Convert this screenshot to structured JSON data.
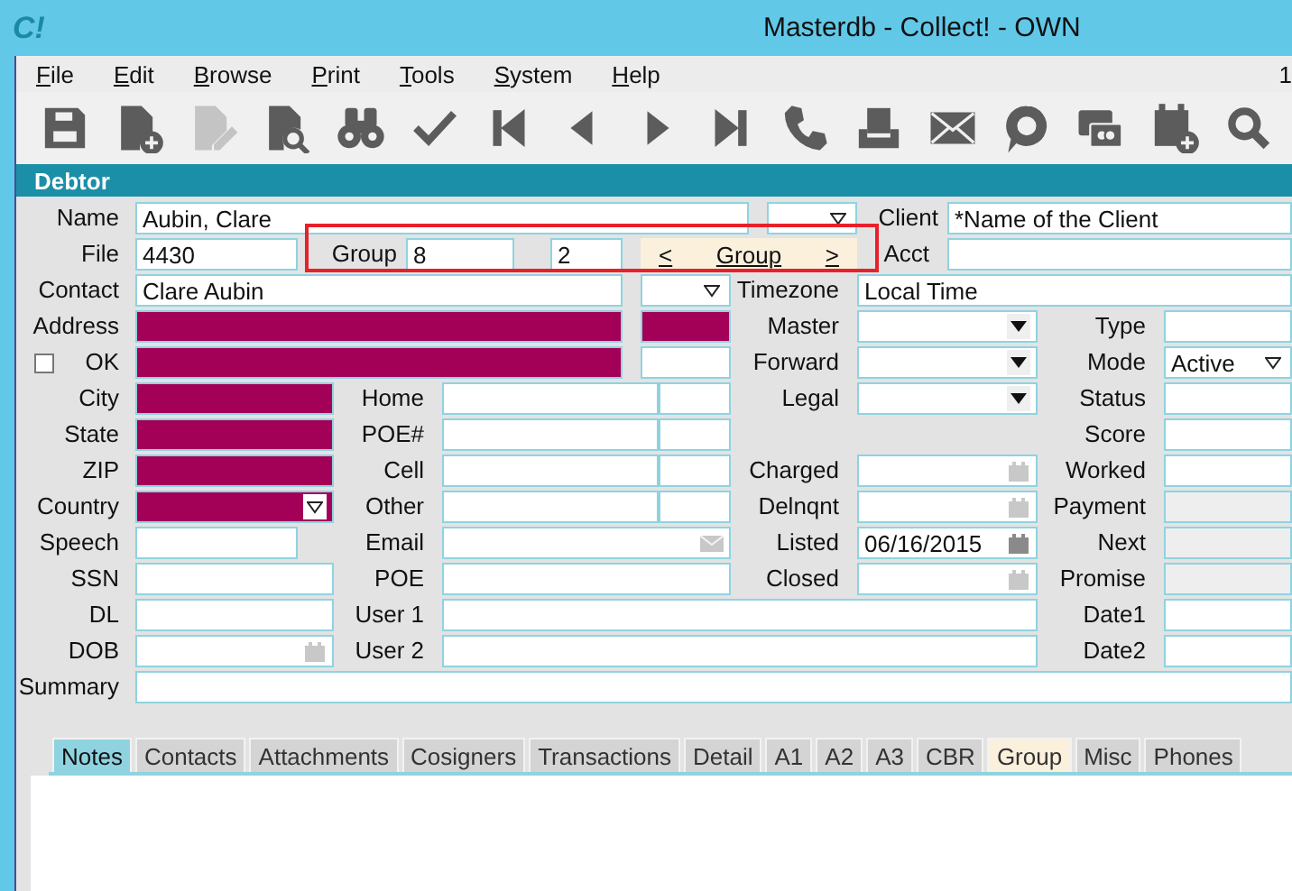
{
  "window": {
    "logo": "C!",
    "title": "Masterdb - Collect! - OWN"
  },
  "menu": [
    "File",
    "Edit",
    "Browse",
    "Print",
    "Tools",
    "System",
    "Help"
  ],
  "menu_extra": "1",
  "toolbar": [
    {
      "kind": "save",
      "disabled": false
    },
    {
      "kind": "new",
      "disabled": false
    },
    {
      "kind": "edit",
      "disabled": true
    },
    {
      "kind": "finddoc",
      "disabled": false
    },
    {
      "kind": "binoculars",
      "disabled": false
    },
    {
      "kind": "check",
      "disabled": false
    },
    {
      "kind": "first",
      "disabled": false
    },
    {
      "kind": "prev",
      "disabled": false
    },
    {
      "kind": "next",
      "disabled": false
    },
    {
      "kind": "last",
      "disabled": false
    },
    {
      "kind": "phone",
      "disabled": false
    },
    {
      "kind": "tray",
      "disabled": false
    },
    {
      "kind": "mail",
      "disabled": false
    },
    {
      "kind": "chat",
      "disabled": false
    },
    {
      "kind": "card",
      "disabled": false
    },
    {
      "kind": "calendar",
      "disabled": false
    },
    {
      "kind": "search",
      "disabled": false
    }
  ],
  "section": "Debtor",
  "group_box": {
    "highlighted": true
  },
  "form": [
    [
      {
        "kind": "label",
        "text": "Name"
      },
      {
        "kind": "field",
        "value": "Aubin, Clare"
      },
      {
        "kind": "combo"
      },
      {
        "kind": "label",
        "text": "Client"
      },
      {
        "kind": "field",
        "value": "*Name of the Client"
      }
    ],
    [
      {
        "kind": "label",
        "text": "File"
      },
      {
        "kind": "field",
        "value": "4430"
      },
      {
        "kind": "label",
        "text": "Group"
      },
      {
        "kind": "field",
        "value": "8"
      },
      {
        "kind": "field",
        "value": "2"
      },
      {
        "kind": "nav",
        "prev": "<",
        "text": "Group",
        "next": ">"
      },
      {
        "kind": "label",
        "text": "Acct"
      },
      {
        "kind": "field"
      }
    ],
    [
      {
        "kind": "label",
        "text": "Contact"
      },
      {
        "kind": "field",
        "value": "Clare Aubin"
      },
      {
        "kind": "combo"
      },
      {
        "kind": "label",
        "text": "Timezone"
      },
      {
        "kind": "field",
        "value": "Local Time"
      }
    ],
    [
      {
        "kind": "label",
        "text": "Address"
      },
      {
        "kind": "field",
        "required": true
      },
      {
        "kind": "field",
        "required": true
      },
      {
        "kind": "label",
        "text": "Master"
      },
      {
        "kind": "select"
      },
      {
        "kind": "label",
        "text": "Type"
      },
      {
        "kind": "field"
      }
    ],
    [
      {
        "kind": "check",
        "checked": false
      },
      {
        "kind": "label",
        "text": "OK"
      },
      {
        "kind": "field",
        "required": true
      },
      {
        "kind": "field"
      },
      {
        "kind": "label",
        "text": "Forward"
      },
      {
        "kind": "select"
      },
      {
        "kind": "label",
        "text": "Mode"
      },
      {
        "kind": "combo",
        "value": "Active"
      }
    ],
    [
      {
        "kind": "label",
        "text": "City"
      },
      {
        "kind": "field",
        "required": true
      },
      {
        "kind": "label",
        "text": "Home"
      },
      {
        "kind": "field"
      },
      {
        "kind": "field"
      },
      {
        "kind": "label",
        "text": "Legal"
      },
      {
        "kind": "select"
      },
      {
        "kind": "label",
        "text": "Status"
      },
      {
        "kind": "field"
      }
    ],
    [
      {
        "kind": "label",
        "text": "State"
      },
      {
        "kind": "field",
        "required": true
      },
      {
        "kind": "label",
        "text": "POE#"
      },
      {
        "kind": "field"
      },
      {
        "kind": "field"
      },
      {
        "kind": "label",
        "text": "Score"
      },
      {
        "kind": "field"
      }
    ],
    [
      {
        "kind": "label",
        "text": "ZIP"
      },
      {
        "kind": "field",
        "required": true
      },
      {
        "kind": "label",
        "text": "Cell"
      },
      {
        "kind": "field"
      },
      {
        "kind": "field"
      },
      {
        "kind": "label",
        "text": "Charged"
      },
      {
        "kind": "date"
      },
      {
        "kind": "label",
        "text": "Worked"
      },
      {
        "kind": "field"
      }
    ],
    [
      {
        "kind": "label",
        "text": "Country"
      },
      {
        "kind": "combo",
        "required": true
      },
      {
        "kind": "label",
        "text": "Other"
      },
      {
        "kind": "field"
      },
      {
        "kind": "field"
      },
      {
        "kind": "label",
        "text": "Delnqnt"
      },
      {
        "kind": "date"
      },
      {
        "kind": "label",
        "text": "Payment"
      },
      {
        "kind": "field",
        "disabled": true
      }
    ],
    [
      {
        "kind": "label",
        "text": "Speech"
      },
      {
        "kind": "field"
      },
      {
        "kind": "label",
        "text": "Email"
      },
      {
        "kind": "email"
      },
      {
        "kind": "label",
        "text": "Listed"
      },
      {
        "kind": "date",
        "value": "06/16/2015"
      },
      {
        "kind": "label",
        "text": "Next"
      },
      {
        "kind": "field",
        "disabled": true
      }
    ],
    [
      {
        "kind": "label",
        "text": "SSN"
      },
      {
        "kind": "field"
      },
      {
        "kind": "label",
        "text": "POE"
      },
      {
        "kind": "field"
      },
      {
        "kind": "label",
        "text": "Closed"
      },
      {
        "kind": "date"
      },
      {
        "kind": "label",
        "text": "Promise"
      },
      {
        "kind": "field",
        "disabled": true
      }
    ],
    [
      {
        "kind": "label",
        "text": "DL"
      },
      {
        "kind": "field"
      },
      {
        "kind": "label",
        "text": "User 1"
      },
      {
        "kind": "field"
      },
      {
        "kind": "label",
        "text": "Date1"
      },
      {
        "kind": "field"
      }
    ],
    [
      {
        "kind": "label",
        "text": "DOB"
      },
      {
        "kind": "date"
      },
      {
        "kind": "label",
        "text": "User 2"
      },
      {
        "kind": "field"
      },
      {
        "kind": "label",
        "text": "Date2"
      },
      {
        "kind": "field"
      }
    ],
    [
      {
        "kind": "label",
        "text": "Summary"
      },
      {
        "kind": "field"
      }
    ]
  ],
  "tabs": [
    {
      "label": "Notes",
      "selected": true,
      "highlighted": false
    },
    {
      "label": "Contacts",
      "selected": false,
      "highlighted": false
    },
    {
      "label": "Attachments",
      "selected": false,
      "highlighted": false
    },
    {
      "label": "Cosigners",
      "selected": false,
      "highlighted": false
    },
    {
      "label": "Transactions",
      "selected": false,
      "highlighted": false
    },
    {
      "label": "Detail",
      "selected": false,
      "highlighted": false
    },
    {
      "label": "A1",
      "selected": false,
      "highlighted": false
    },
    {
      "label": "A2",
      "selected": false,
      "highlighted": false
    },
    {
      "label": "A3",
      "selected": false,
      "highlighted": false
    },
    {
      "label": "CBR",
      "selected": false,
      "highlighted": false
    },
    {
      "label": "Group",
      "selected": false,
      "highlighted": true
    },
    {
      "label": "Misc",
      "selected": false,
      "highlighted": false
    },
    {
      "label": "Phones",
      "selected": false,
      "highlighted": false
    }
  ]
}
